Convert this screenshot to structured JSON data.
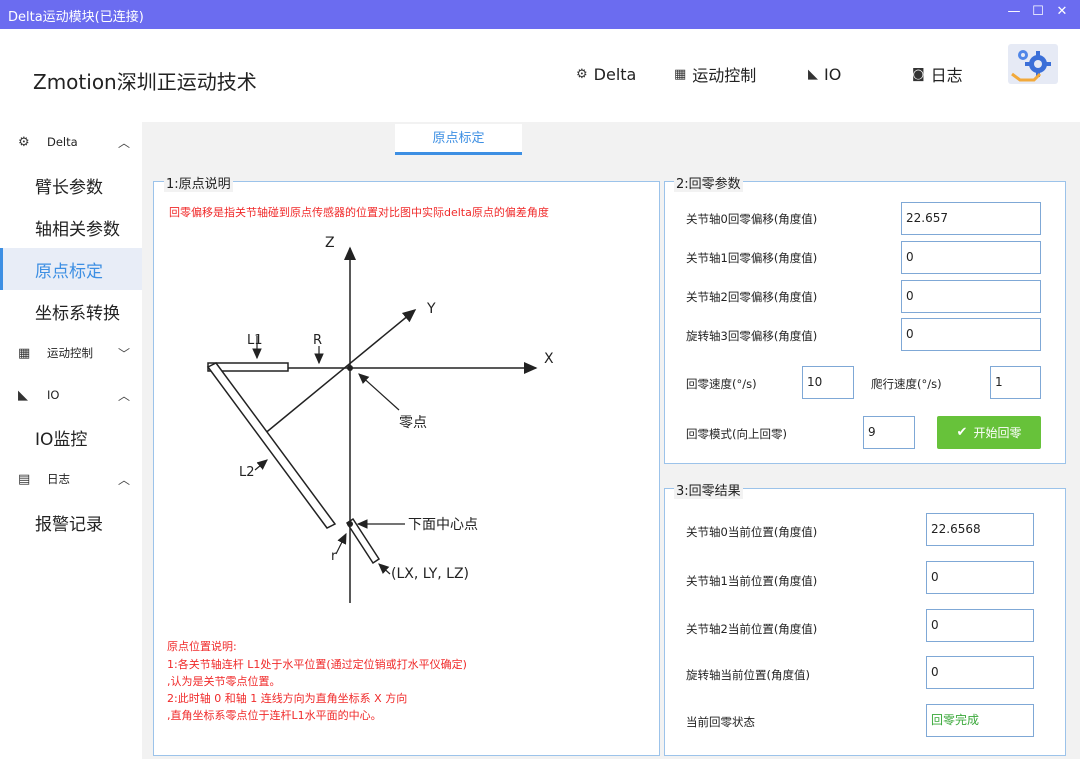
{
  "window": {
    "title": "Delta运动模块(已连接)",
    "min": "—",
    "max": "☐",
    "close": "✕"
  },
  "brand": "Zmotion深圳正运动技术",
  "topnav": [
    {
      "icon": "gears-icon",
      "glyph": "⚙",
      "label": "Delta"
    },
    {
      "icon": "windows-icon",
      "glyph": "▦",
      "label": "运动控制"
    },
    {
      "icon": "area-chart-icon",
      "glyph": "◣",
      "label": "IO"
    },
    {
      "icon": "clipboard-icon",
      "glyph": "◙",
      "label": "日志"
    }
  ],
  "sidebar": {
    "groups": [
      {
        "icon": "gears-icon",
        "glyph": "⚙",
        "label": "Delta",
        "chevron": "︿"
      },
      {
        "icon": "windows-icon",
        "glyph": "▦",
        "label": "运动控制",
        "chevron": "﹀"
      },
      {
        "icon": "area-chart-icon",
        "glyph": "◣",
        "label": "IO",
        "chevron": "︿"
      },
      {
        "icon": "list-icon",
        "glyph": "▤",
        "label": "日志",
        "chevron": "︿"
      }
    ],
    "items": [
      "臂长参数",
      "轴相关参数",
      "原点标定",
      "坐标系转换",
      "IO监控",
      "报警记录"
    ]
  },
  "tab": "原点标定",
  "panel1": {
    "title": "1:原点说明",
    "note": "回零偏移是指关节轴碰到原点传感器的位置对比图中实际delta原点的偏差角度",
    "diagram": {
      "z": "Z",
      "x": "X",
      "y": "Y",
      "l1": "L1",
      "l2": "L2",
      "r_big": "R",
      "r_small": "r",
      "zero": "零点",
      "bottom_center": "下面中心点",
      "coords": "(LX, LY, LZ)"
    },
    "desc": [
      "原点位置说明:",
      "1:各关节轴连杆 L1处于水平位置(通过定位销或打水平仪确定)",
      ",认为是关节零点位置。",
      "2:此时轴 0 和轴 1 连线方向为直角坐标系 X 方向",
      ",直角坐标系零点位于连杆L1水平面的中心。"
    ]
  },
  "panel2": {
    "title": "2:回零参数",
    "offsets": [
      {
        "label": "关节轴0回零偏移(角度值)",
        "value": "22.657"
      },
      {
        "label": "关节轴1回零偏移(角度值)",
        "value": "0"
      },
      {
        "label": "关节轴2回零偏移(角度值)",
        "value": "0"
      },
      {
        "label": "旋转轴3回零偏移(角度值)",
        "value": "0"
      }
    ],
    "home_speed_label": "回零速度(°/s)",
    "home_speed": "10",
    "creep_speed_label": "爬行速度(°/s)",
    "creep_speed": "1",
    "home_mode_label": "回零模式(向上回零)",
    "home_mode": "9",
    "start_button": "开始回零"
  },
  "panel3": {
    "title": "3:回零结果",
    "positions": [
      {
        "label": "关节轴0当前位置(角度值)",
        "value": "22.6568"
      },
      {
        "label": "关节轴1当前位置(角度值)",
        "value": "0"
      },
      {
        "label": "关节轴2当前位置(角度值)",
        "value": "0"
      },
      {
        "label": "旋转轴当前位置(角度值)",
        "value": "0"
      }
    ],
    "status_label": "当前回零状态",
    "status": "回零完成"
  }
}
